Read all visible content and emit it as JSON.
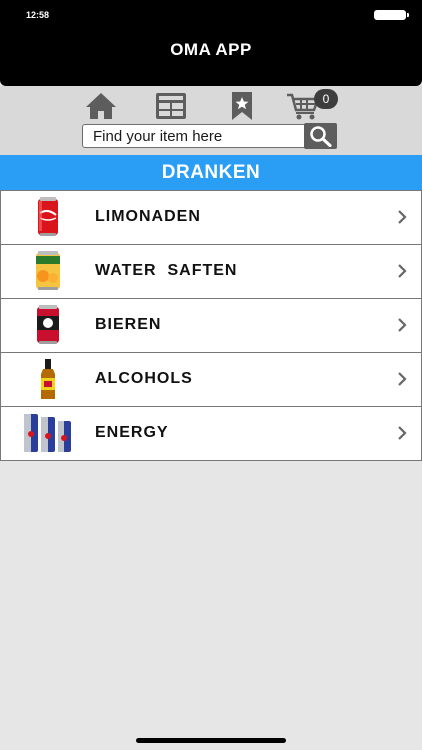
{
  "status_bar": {
    "time": "12:58"
  },
  "app": {
    "title": "OMA APP"
  },
  "toolbar": {
    "icons": [
      "home-icon",
      "grid-icon",
      "bookmark-icon",
      "cart-icon"
    ],
    "cart_count": "0"
  },
  "search": {
    "placeholder": "Find your item here",
    "value": ""
  },
  "category": {
    "title": "DRANKEN"
  },
  "items": [
    {
      "label": "LIMONADEN",
      "thumbnail": "soda-can"
    },
    {
      "label": "WATER  SAFTEN",
      "thumbnail": "juice-can"
    },
    {
      "label": "BIEREN",
      "thumbnail": "beer-can"
    },
    {
      "label": "ALCOHOLS",
      "thumbnail": "liquor-bottle"
    },
    {
      "label": "ENERGY",
      "thumbnail": "energy-cans"
    }
  ],
  "colors": {
    "header_bar": "#000000",
    "category_bar": "#2a9df4",
    "toolbar_bg": "#d9d9d9",
    "page_bg": "#e6e6e6",
    "icon_gray": "#5d5d5d"
  }
}
